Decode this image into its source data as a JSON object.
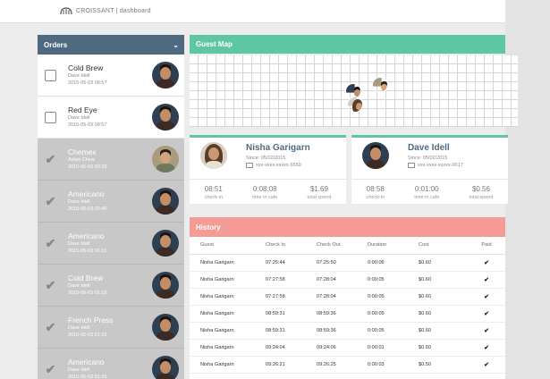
{
  "header": {
    "brand": "CROISSANT | dashboard"
  },
  "orders": {
    "title": "Orders",
    "items": [
      {
        "name": "Cold Brew",
        "customer": "Dave Idell",
        "time": "2015-05-03 08:57",
        "done": false,
        "avatar": "dave"
      },
      {
        "name": "Red Eye",
        "customer": "Dave Idell",
        "time": "2015-05-03 08:57",
        "done": false,
        "avatar": "dave"
      },
      {
        "name": "Chemex",
        "customer": "Adam Chew",
        "time": "2015-05-03 00:39",
        "done": true,
        "avatar": "adam"
      },
      {
        "name": "Americano",
        "customer": "Dave Idell",
        "time": "2015-05-03 00:40",
        "done": true,
        "avatar": "dave"
      },
      {
        "name": "Americano",
        "customer": "Dave Idell",
        "time": "2015-05-03 01:15",
        "done": true,
        "avatar": "dave"
      },
      {
        "name": "Cold Brew",
        "customer": "Dave Idell",
        "time": "2015-05-03 01:15",
        "done": true,
        "avatar": "dave"
      },
      {
        "name": "French Press",
        "customer": "Dave Idell",
        "time": "2015-05-03 01:15",
        "done": true,
        "avatar": "dave"
      },
      {
        "name": "Americano",
        "customer": "Dave Idell",
        "time": "2015-05-03 01:15",
        "done": true,
        "avatar": "dave"
      }
    ]
  },
  "guest_map": {
    "title": "Guest Map"
  },
  "guests": [
    {
      "name": "Nisha Garigarn",
      "since": "Since: 05/02/2015",
      "card": "xxx-xxxx-xxxxx-5559",
      "avatar": "nisha",
      "stats": [
        {
          "value": "08:51",
          "label": "check-in"
        },
        {
          "value": "0:08:08",
          "label": "time in cafe"
        },
        {
          "value": "$1.69",
          "label": "total spend"
        }
      ]
    },
    {
      "name": "Dave Idell",
      "since": "Since: 05/02/2015",
      "card": "xxx-xxxx-xxxxx-0017",
      "avatar": "dave",
      "stats": [
        {
          "value": "08:58",
          "label": "check-in"
        },
        {
          "value": "0:01:00",
          "label": "time in cafe"
        },
        {
          "value": "$0.56",
          "label": "total spend"
        }
      ]
    }
  ],
  "history": {
    "title": "History",
    "columns": [
      "Guest",
      "Check In",
      "Check Out",
      "Duration",
      "Cost",
      "Paid"
    ],
    "rows": [
      [
        "Nisha Garigarn",
        "07:25:44",
        "07:25:50",
        "0:00:06",
        "$0.60",
        "✔"
      ],
      [
        "Nisha Garigarn",
        "07:27:58",
        "07:28:04",
        "0:00:05",
        "$0.60",
        "✔"
      ],
      [
        "Nisha Garigarn",
        "07:27:58",
        "07:28:04",
        "0:00:05",
        "$0.60",
        "✔"
      ],
      [
        "Nisha Garigarn",
        "08:59:31",
        "08:59:36",
        "0:00:05",
        "$0.60",
        "✔"
      ],
      [
        "Nisha Garigarn",
        "08:59:31",
        "08:59:36",
        "0:00:05",
        "$0.60",
        "✔"
      ],
      [
        "Nisha Garigarn",
        "09:24:04",
        "09:24:06",
        "0:00:01",
        "$0.60",
        "✔"
      ],
      [
        "Nisha Garigarn",
        "09:26:21",
        "09:26:25",
        "0:00:03",
        "$0.50",
        "✔"
      ]
    ]
  },
  "colors": {
    "orders_header": "#4f6a80",
    "map_header": "#5ec6a3",
    "history_header": "#f59b95"
  }
}
